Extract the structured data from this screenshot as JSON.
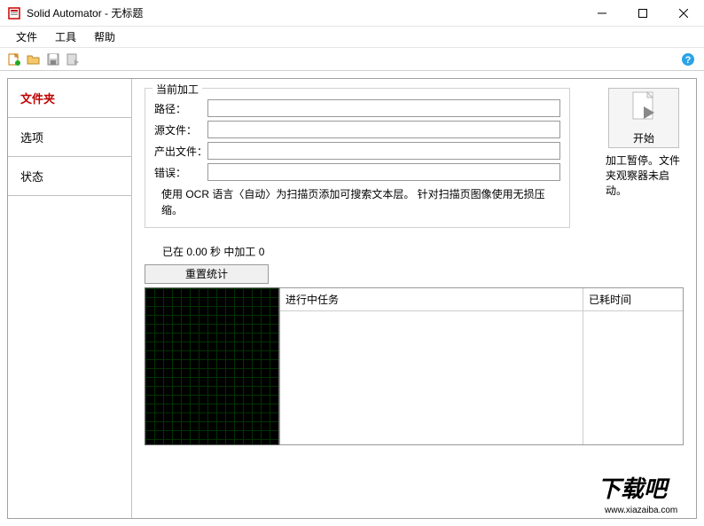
{
  "window": {
    "title": "Solid Automator - 无标题"
  },
  "menu": {
    "file": "文件",
    "tools": "工具",
    "help": "帮助"
  },
  "sidebar": {
    "folder": "文件夹",
    "options": "选项",
    "status": "状态"
  },
  "processing": {
    "legend": "当前加工",
    "path_label": "路径：",
    "path_value": "",
    "source_label": "源文件：",
    "source_value": "",
    "output_label": "产出文件：",
    "output_value": "",
    "error_label": "错误：",
    "error_value": "",
    "description": "使用 OCR 语言〈自动〉为扫描页添加可搜索文本层。 针对扫描页图像使用无损压缩。"
  },
  "start": {
    "button_label": "开始",
    "status_text": "加工暂停。文件夹观察器未启动。"
  },
  "stats": {
    "summary": "已在 0.00 秒 中加工 0",
    "reset_label": "重置统计"
  },
  "task_table": {
    "col_task": "进行中任务",
    "col_time": "已耗时间"
  },
  "watermark": {
    "text": "下载吧",
    "url": "www.xiazaiba.com"
  }
}
